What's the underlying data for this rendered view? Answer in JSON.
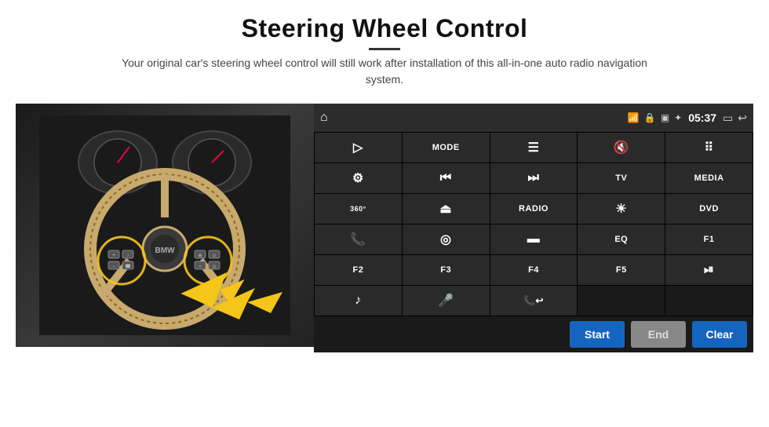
{
  "header": {
    "title": "Steering Wheel Control",
    "subtitle": "Your original car's steering wheel control will still work after installation of this all-in-one auto radio navigation system."
  },
  "status_bar": {
    "time": "05:37"
  },
  "grid_buttons": [
    {
      "id": "row1-1",
      "icon": "▷",
      "label": "",
      "type": "icon"
    },
    {
      "id": "row1-2",
      "icon": "",
      "label": "MODE",
      "type": "text"
    },
    {
      "id": "row1-3",
      "icon": "≡",
      "label": "",
      "type": "icon"
    },
    {
      "id": "row1-4",
      "icon": "🔇",
      "label": "",
      "type": "icon"
    },
    {
      "id": "row1-5",
      "icon": "⠿",
      "label": "",
      "type": "icon"
    },
    {
      "id": "row2-1",
      "icon": "◎",
      "label": "",
      "type": "icon"
    },
    {
      "id": "row2-2",
      "icon": "⏮",
      "label": "",
      "type": "icon"
    },
    {
      "id": "row2-3",
      "icon": "⏭",
      "label": "",
      "type": "icon"
    },
    {
      "id": "row2-4",
      "icon": "",
      "label": "TV",
      "type": "text"
    },
    {
      "id": "row2-5",
      "icon": "",
      "label": "MEDIA",
      "type": "text"
    },
    {
      "id": "row3-1",
      "icon": "⊞",
      "label": "",
      "type": "icon"
    },
    {
      "id": "row3-2",
      "icon": "▲",
      "label": "",
      "type": "icon"
    },
    {
      "id": "row3-3",
      "icon": "",
      "label": "RADIO",
      "type": "text"
    },
    {
      "id": "row3-4",
      "icon": "☀",
      "label": "",
      "type": "icon"
    },
    {
      "id": "row3-5",
      "icon": "",
      "label": "DVD",
      "type": "text"
    },
    {
      "id": "row4-1",
      "icon": "📞",
      "label": "",
      "type": "icon"
    },
    {
      "id": "row4-2",
      "icon": "◌",
      "label": "",
      "type": "icon"
    },
    {
      "id": "row4-3",
      "icon": "▬",
      "label": "",
      "type": "icon"
    },
    {
      "id": "row4-4",
      "icon": "",
      "label": "EQ",
      "type": "text"
    },
    {
      "id": "row4-5",
      "icon": "",
      "label": "F1",
      "type": "text"
    },
    {
      "id": "row5-1",
      "icon": "",
      "label": "F2",
      "type": "text"
    },
    {
      "id": "row5-2",
      "icon": "",
      "label": "F3",
      "type": "text"
    },
    {
      "id": "row5-3",
      "icon": "",
      "label": "F4",
      "type": "text"
    },
    {
      "id": "row5-4",
      "icon": "",
      "label": "F5",
      "type": "text"
    },
    {
      "id": "row5-5",
      "icon": "⏯",
      "label": "",
      "type": "icon"
    },
    {
      "id": "row6-1",
      "icon": "♪",
      "label": "",
      "type": "icon"
    },
    {
      "id": "row6-2",
      "icon": "🎤",
      "label": "",
      "type": "icon"
    },
    {
      "id": "row6-3",
      "icon": "📞✓",
      "label": "",
      "type": "icon"
    },
    {
      "id": "row6-4",
      "icon": "",
      "label": "",
      "type": "empty"
    },
    {
      "id": "row6-5",
      "icon": "",
      "label": "",
      "type": "empty"
    }
  ],
  "bottom_buttons": {
    "start": "Start",
    "end": "End",
    "clear": "Clear"
  }
}
